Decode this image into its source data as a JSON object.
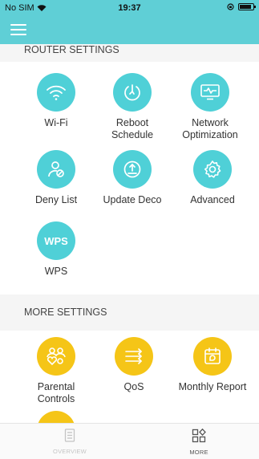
{
  "status_bar": {
    "carrier": "No SIM",
    "time": "19:37"
  },
  "router_settings": {
    "title": "ROUTER SETTINGS",
    "items": [
      {
        "label": "Wi-Fi",
        "icon": "wifi-icon"
      },
      {
        "label": "Reboot\nSchedule",
        "icon": "power-clock-icon"
      },
      {
        "label": "Network\nOptimization",
        "icon": "monitor-pulse-icon"
      },
      {
        "label": "Deny List",
        "icon": "blocked-user-icon"
      },
      {
        "label": "Update Deco",
        "icon": "upload-icon"
      },
      {
        "label": "Advanced",
        "icon": "gear-icon"
      },
      {
        "label": "WPS",
        "icon": "wps-icon",
        "icon_text": "WPS"
      }
    ]
  },
  "more_settings": {
    "title": "MORE SETTINGS",
    "items": [
      {
        "label": "Parental\nControls",
        "icon": "family-icon"
      },
      {
        "label": "QoS",
        "icon": "qos-arrows-icon"
      },
      {
        "label": "Monthly Report",
        "icon": "calendar-report-icon"
      }
    ]
  },
  "tab_bar": {
    "tabs": [
      {
        "label": "OVERVIEW",
        "icon": "document-icon",
        "active": false
      },
      {
        "label": "MORE",
        "icon": "grid-diamond-icon",
        "active": true
      }
    ]
  },
  "colors": {
    "header": "#5fcfd6",
    "teal_icon": "#4fd0d7",
    "yellow_icon": "#f5c517"
  }
}
